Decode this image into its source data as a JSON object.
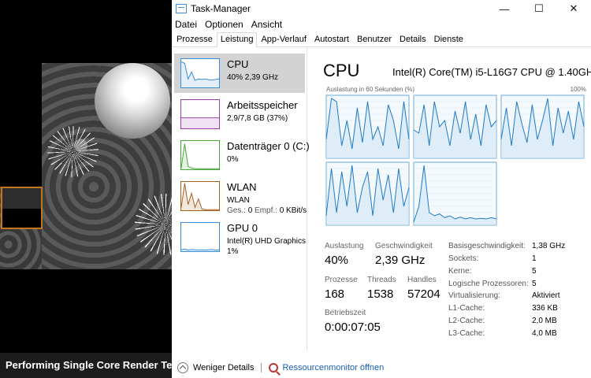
{
  "background": {
    "caption": "Performing Single Core Render Te"
  },
  "window": {
    "title": "Task-Manager",
    "controls": {
      "minimize": "—",
      "maximize": "☐",
      "close": "✕"
    },
    "menu": [
      "Datei",
      "Optionen",
      "Ansicht"
    ],
    "tabs": [
      "Prozesse",
      "Leistung",
      "App-Verlauf",
      "Autostart",
      "Benutzer",
      "Details",
      "Dienste"
    ],
    "active_tab": "Leistung"
  },
  "sidebar": {
    "items": [
      {
        "name": "CPU",
        "line1": "40% 2,39 GHz",
        "line2": "",
        "color": "#3b8ed8",
        "selected": true,
        "spark": [
          0.9,
          0.85,
          0.3,
          0.55,
          0.25,
          0.3,
          0.28,
          0.3,
          0.27,
          0.26,
          0.28,
          0.3
        ]
      },
      {
        "name": "Arbeitsspeicher",
        "line1": "2,9/7,8 GB (37%)",
        "line2": "",
        "color": "#9b3fb0",
        "selected": false,
        "spark": [
          0.37,
          0.37,
          0.37,
          0.37,
          0.37,
          0.37,
          0.37,
          0.37,
          0.37,
          0.37,
          0.37,
          0.37
        ]
      },
      {
        "name": "Datenträger 0 (C:)",
        "line1": "0%",
        "line2": "",
        "color": "#4aa63a",
        "selected": false,
        "spark": [
          0.05,
          0.9,
          0.1,
          0.05,
          0.02,
          0.02,
          0.02,
          0.02,
          0.02,
          0.02,
          0.02,
          0.02
        ]
      },
      {
        "name": "WLAN",
        "line1": "WLAN",
        "line2_label_send": "Ges.:",
        "line2_send": "0",
        "line2_label_recv": "Empf.:",
        "line2_recv": "0 KBit/s",
        "color": "#a9601c",
        "selected": false,
        "spark": [
          0.1,
          0.95,
          0.2,
          0.6,
          0.1,
          0.4,
          0.05,
          0.02,
          0.02,
          0.02,
          0.02,
          0.02
        ]
      },
      {
        "name": "GPU 0",
        "line1": "Intel(R) UHD Graphics",
        "line2": "1%",
        "color": "#3b8ed8",
        "selected": false,
        "spark": [
          0.05,
          0.08,
          0.04,
          0.06,
          0.05,
          0.04,
          0.05,
          0.04,
          0.05,
          0.06,
          0.04,
          0.05
        ]
      }
    ]
  },
  "cpu": {
    "title": "CPU",
    "model": "Intel(R) Core(TM) i5-L16G7 CPU @ 1.40GHz",
    "graph_caption": "Auslastung in 60 Sekunden (%)",
    "graph_max": "100%",
    "core_graphs": [
      [
        0.3,
        0.95,
        0.9,
        0.2,
        0.6,
        0.15,
        0.8,
        0.25,
        0.9,
        0.3,
        0.5,
        0.2,
        0.85,
        0.6,
        0.15,
        0.9,
        0.3
      ],
      [
        0.45,
        0.4,
        0.85,
        0.2,
        0.9,
        0.5,
        0.6,
        0.2,
        0.75,
        0.4,
        0.9,
        0.3,
        0.7,
        0.2,
        0.85,
        0.5,
        0.6
      ],
      [
        0.3,
        0.8,
        0.2,
        0.9,
        0.55,
        0.25,
        0.85,
        0.3,
        0.6,
        0.95,
        0.2,
        0.8,
        0.4,
        0.75,
        0.3,
        0.9,
        0.5
      ],
      [
        0.15,
        0.9,
        0.2,
        0.85,
        0.3,
        0.95,
        0.2,
        0.6,
        0.85,
        0.15,
        0.9,
        0.4,
        0.8,
        0.2,
        0.9,
        0.3,
        0.6
      ],
      [
        0.05,
        0.3,
        0.95,
        0.2,
        0.15,
        0.18,
        0.12,
        0.15,
        0.1,
        0.13,
        0.1,
        0.12,
        0.1,
        0.11,
        0.1,
        0.12,
        0.1
      ]
    ],
    "stats": {
      "auslastung_label": "Auslastung",
      "auslastung": "40%",
      "geschwindigkeit_label": "Geschwindigkeit",
      "geschwindigkeit": "2,39 GHz",
      "prozesse_label": "Prozesse",
      "prozesse": "168",
      "threads_label": "Threads",
      "threads": "1538",
      "handles_label": "Handles",
      "handles": "57204",
      "betriebszeit_label": "Betriebszeit",
      "betriebszeit": "0:00:07:05"
    },
    "info": [
      {
        "label": "Basisgeschwindigkeit:",
        "value": "1,38 GHz"
      },
      {
        "label": "Sockets:",
        "value": "1"
      },
      {
        "label": "Kerne:",
        "value": "5"
      },
      {
        "label": "Logische Prozessoren:",
        "value": "5"
      },
      {
        "label": "Virtualisierung:",
        "value": "Aktiviert"
      },
      {
        "label": "L1-Cache:",
        "value": "336 KB"
      },
      {
        "label": "L2-Cache:",
        "value": "2,0 MB"
      },
      {
        "label": "L3-Cache:",
        "value": "4,0 MB"
      }
    ]
  },
  "footer": {
    "less_details": "Weniger Details",
    "resource_monitor": "Ressourcenmonitor öffnen"
  }
}
